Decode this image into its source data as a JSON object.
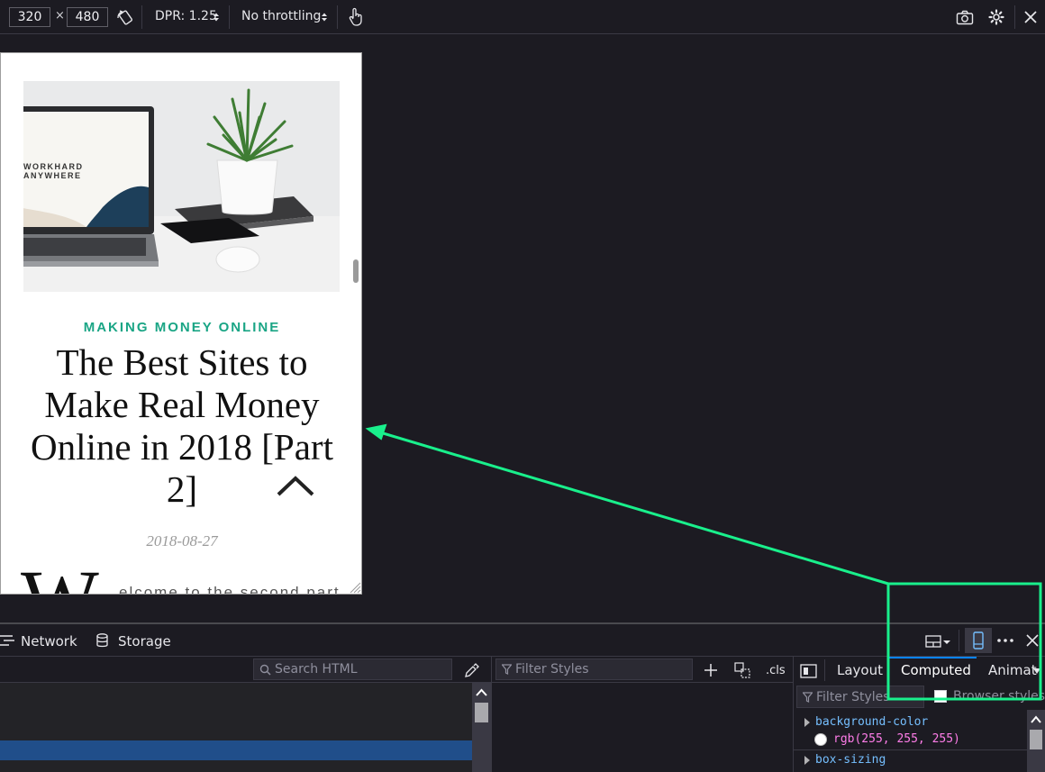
{
  "rdm": {
    "width": "320",
    "times": "×",
    "height": "480",
    "dpr": "DPR: 1.25",
    "throttling": "No throttling",
    "icons": [
      "rotate-icon",
      "touch-icon",
      "screenshot-icon",
      "settings-icon",
      "close-icon"
    ]
  },
  "page": {
    "laptop_screen_text": "WORKHARD\nANYWHERE",
    "category": "MAKING MONEY ONLINE",
    "title": "The Best Sites to Make Real Money Online in 2018 [Part 2]",
    "date": "2018-08-27",
    "dropcap": "W",
    "intro": "elcome to the second part"
  },
  "devtools": {
    "tabs": {
      "network": "Network",
      "storage": "Storage"
    },
    "search_html_placeholder": "Search HTML",
    "filter_styles_placeholder": "Filter Styles",
    "cls_label": ".cls",
    "sidebar_tabs": {
      "layout": "Layout",
      "computed": "Computed",
      "animations": "Animat"
    },
    "computed_filter_placeholder": "Filter Styles",
    "browser_styles_label": "Browser styles",
    "properties": [
      {
        "name": "background-color",
        "value": "rgb(255, 255, 255)"
      },
      {
        "name": "box-sizing",
        "value": ""
      }
    ]
  },
  "colors": {
    "accent_green": "#1aa585",
    "annotation": "#19f08c",
    "selection_blue": "#204e8a",
    "active_tab": "#0a84ff"
  }
}
